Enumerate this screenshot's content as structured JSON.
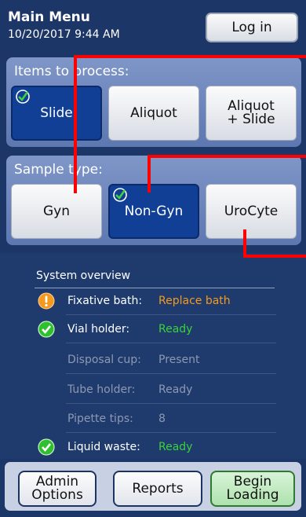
{
  "header": {
    "title": "Main Menu",
    "datetime": "10/20/2017 9:44 AM",
    "login_label": "Log in"
  },
  "items_panel": {
    "title": "Items to process:",
    "options": [
      {
        "label": "Slide",
        "selected": true
      },
      {
        "label": "Aliquot",
        "selected": false
      },
      {
        "label": "Aliquot + Slide",
        "selected": false
      }
    ]
  },
  "sample_panel": {
    "title": "Sample type:",
    "options": [
      {
        "label": "Gyn",
        "selected": false
      },
      {
        "label": "Non-Gyn",
        "selected": true
      },
      {
        "label": "UroCyte",
        "selected": false
      }
    ]
  },
  "overview": {
    "title": "System overview",
    "rows": [
      {
        "label": "Fixative bath:",
        "value": "Replace bath",
        "status": "warning"
      },
      {
        "label": "Vial holder:",
        "value": "Ready",
        "status": "ok"
      },
      {
        "label": "Disposal cup:",
        "value": "Present",
        "status": "none"
      },
      {
        "label": "Tube holder:",
        "value": "Ready",
        "status": "none"
      },
      {
        "label": "Pipette tips:",
        "value": "8",
        "status": "none"
      },
      {
        "label": "Liquid waste:",
        "value": "Ready",
        "status": "ok"
      }
    ]
  },
  "bottom": {
    "admin_label_1": "Admin",
    "admin_label_2": "Options",
    "reports_label": "Reports",
    "begin_label_1": "Begin",
    "begin_label_2": "Loading"
  },
  "colors": {
    "background": "#1c3668",
    "selected": "#123f96",
    "ok": "#39d239",
    "warning": "#f39a1f",
    "annotation": "#ff0000"
  }
}
